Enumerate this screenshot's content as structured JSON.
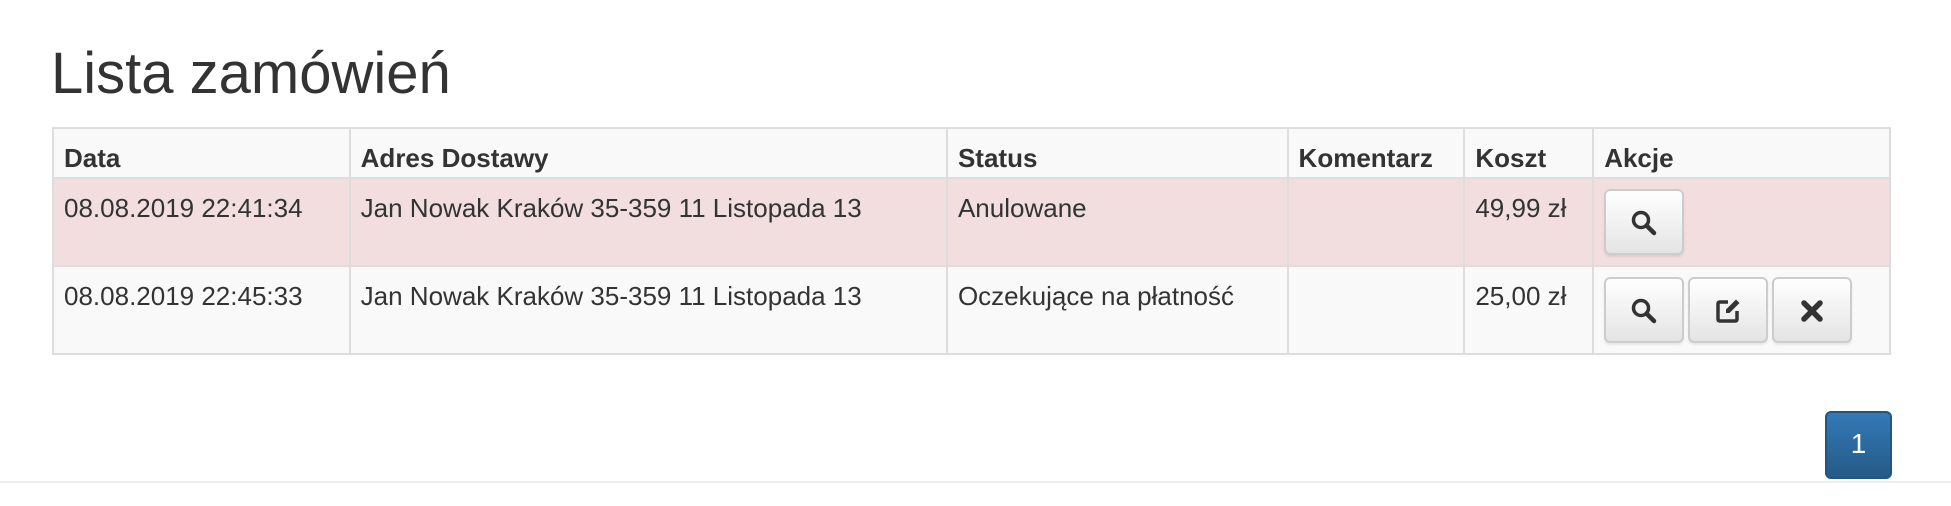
{
  "page": {
    "title": "Lista zamówień"
  },
  "table": {
    "headers": {
      "date": "Data",
      "address": "Adres Dostawy",
      "status": "Status",
      "comment": "Komentarz",
      "cost": "Koszt",
      "actions": "Akcje"
    },
    "rows": [
      {
        "date": "08.08.2019 22:41:34",
        "address": "Jan Nowak Kraków 35-359 11 Listopada 13",
        "status": "Anulowane",
        "comment": "",
        "cost": "49,99 zł",
        "row_color": "#f2dede",
        "actions": [
          "search-icon"
        ]
      },
      {
        "date": "08.08.2019 22:45:33",
        "address": "Jan Nowak Kraków 35-359 11 Listopada 13",
        "status": "Oczekujące na płatność",
        "comment": "",
        "cost": "25,00 zł",
        "row_color": "#f9f9f9",
        "actions": [
          "search-icon",
          "edit-icon",
          "close-icon"
        ]
      }
    ]
  },
  "pagination": {
    "current_page": "1",
    "active_color": "#337ab7"
  }
}
